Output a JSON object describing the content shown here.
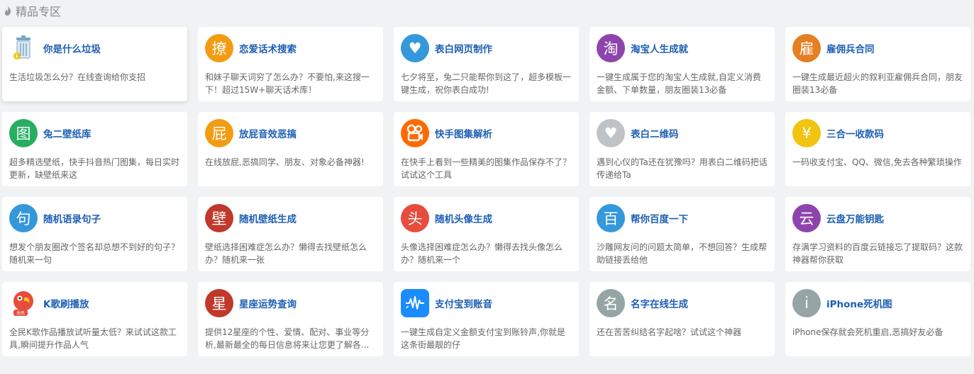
{
  "section": {
    "title": "精品专区",
    "icon": "flame-icon"
  },
  "cards": [
    {
      "name": "trash-classify",
      "title": "你是什么垃圾",
      "desc": "生活垃圾怎么分？在线查询给你支招",
      "icon_text": "",
      "icon_name": "trash-bin-icon",
      "color": "#ffffff"
    },
    {
      "name": "love-talk-search",
      "title": "恋爱话术搜索",
      "desc": "和妹子聊天词穷了怎么办？不要怕,来这搜一下！超过15W+聊天话术库！",
      "icon_text": "撩",
      "icon_name": "liao-char-icon",
      "color": "#f39c12"
    },
    {
      "name": "confession-page",
      "title": "表白网页制作",
      "desc": "七夕将至，兔二只能帮你到这了，超多模板一键生成，祝你表白成功!",
      "icon_text": "♥",
      "icon_name": "heart-icon",
      "color": "#3498db"
    },
    {
      "name": "taobao-life",
      "title": "淘宝人生成就",
      "desc": "一键生成属于您的淘宝人生成就,自定义消费金额、下单数量，朋友圈装13必备",
      "icon_text": "淘",
      "icon_name": "tao-char-icon",
      "color": "#8e44ad"
    },
    {
      "name": "mercenary-contract",
      "title": "雇佣兵合同",
      "desc": "一键生成最近超火的叙利亚雇佣兵合同，朋友圈装13必备",
      "icon_text": "雇",
      "icon_name": "gu-char-icon",
      "color": "#e67e22"
    },
    {
      "name": "wallpaper-lib",
      "title": "兔二壁纸库",
      "desc": "超多精选壁纸，快手抖音热门图集，每日实时更新，缺壁纸来这",
      "icon_text": "图",
      "icon_name": "tu-char-icon",
      "color": "#27ae60"
    },
    {
      "name": "fart-sound",
      "title": "放屁音效恶搞",
      "desc": "在线放屁,恶搞同学、朋友、对象必备神器!",
      "icon_text": "屁",
      "icon_name": "pi-char-icon",
      "color": "#f39c12"
    },
    {
      "name": "kuaishou-parse",
      "title": "快手图集解析",
      "desc": "在快手上看到一些精美的图集作品保存不了？试试这个工具",
      "icon_text": "",
      "icon_name": "kuaishou-logo-icon",
      "color": "#ff6a00"
    },
    {
      "name": "confession-qrcode",
      "title": "表白二维码",
      "desc": "遇到心仪的Ta还在犹豫吗？用表白二维码把话传递给Ta",
      "icon_text": "♥",
      "icon_name": "heart-icon",
      "color": "#bdc3c7"
    },
    {
      "name": "payment-code",
      "title": "三合一收款码",
      "desc": "一码收支付宝、QQ、微信,免去各种繁琐操作",
      "icon_text": "¥",
      "icon_name": "yuan-icon",
      "color": "#f1c40f"
    },
    {
      "name": "random-quote",
      "title": "随机语录句子",
      "desc": "想发个朋友圈改个签名却总想不到好的句子？随机来一句",
      "icon_text": "句",
      "icon_name": "ju-char-icon",
      "color": "#3498db"
    },
    {
      "name": "random-wallpaper",
      "title": "随机壁纸生成",
      "desc": "壁纸选择困难症怎么办？懒得去找壁纸怎么办？随机来一张",
      "icon_text": "壁",
      "icon_name": "bi-char-icon",
      "color": "#c0392b"
    },
    {
      "name": "random-avatar",
      "title": "随机头像生成",
      "desc": "头像选择困难症怎么办？懒得去找头像怎么办？随机来一个",
      "icon_text": "头",
      "icon_name": "tou-char-icon",
      "color": "#e74c3c"
    },
    {
      "name": "baidu-for-you",
      "title": "帮你百度一下",
      "desc": "沙雕网友问的问题太简单，不想回答？生成帮助链接丢给他",
      "icon_text": "百",
      "icon_name": "bai-char-icon",
      "color": "#3498db"
    },
    {
      "name": "pan-key",
      "title": "云盘万能钥匙",
      "desc": "存满学习资料的百度云链接忘了提取码？这款神器帮你获取",
      "icon_text": "云",
      "icon_name": "yun-char-icon",
      "color": "#8e44ad"
    },
    {
      "name": "ksong-play",
      "title": "K歌刷播放",
      "desc": "全民K歌作品播放试听量太低？来试试这款工具,瞬间提升作品人气",
      "icon_text": "",
      "icon_name": "parrot-logo-icon",
      "color": "#e74c3c"
    },
    {
      "name": "horoscope",
      "title": "星座运势查询",
      "desc": "提供12星座的个性、爱情、配对、事业等分析,最新最全的每日信息将来让您更了解各...",
      "icon_text": "星",
      "icon_name": "xing-char-icon",
      "color": "#c0392b"
    },
    {
      "name": "alipay-sound",
      "title": "支付宝到账音",
      "desc": "一键生成自定义金额支付宝到账铃声,你就是这条街最靓的仔",
      "icon_text": "",
      "icon_name": "sound-wave-icon",
      "color": "#1a8cff"
    },
    {
      "name": "name-gen",
      "title": "名字在线生成",
      "desc": "还在苦苦纠结名字起啥？试试这个神器",
      "icon_text": "名",
      "icon_name": "ming-char-icon",
      "color": "#95a5a6"
    },
    {
      "name": "iphone-crash",
      "title": "iPhone死机图",
      "desc": "iPhone保存就会死机重启,恶搞好友必备",
      "icon_text": "i",
      "icon_name": "info-i-icon",
      "color": "#95a5a6"
    }
  ]
}
